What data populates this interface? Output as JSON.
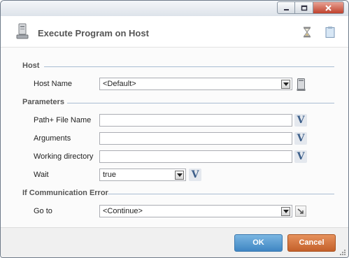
{
  "window": {
    "controls": {
      "minimize_icon": "minimize-icon",
      "maximize_icon": "maximize-icon",
      "close_icon": "close-icon"
    }
  },
  "header": {
    "title": "Execute Program on Host",
    "icon": "computer-icon"
  },
  "sections": {
    "host": {
      "title": "Host",
      "host_name_label": "Host Name",
      "host_name_value": "<Default>"
    },
    "parameters": {
      "title": "Parameters",
      "path_label": "Path+ File Name",
      "path_value": "",
      "arguments_label": "Arguments",
      "arguments_value": "",
      "working_dir_label": "Working directory",
      "working_dir_value": "",
      "wait_label": "Wait",
      "wait_value": "true",
      "variable_button": "V"
    },
    "comm_error": {
      "title": "If Communication Error",
      "goto_label": "Go to",
      "goto_value": "<Continue>"
    }
  },
  "footer": {
    "ok_label": "OK",
    "cancel_label": "Cancel"
  }
}
